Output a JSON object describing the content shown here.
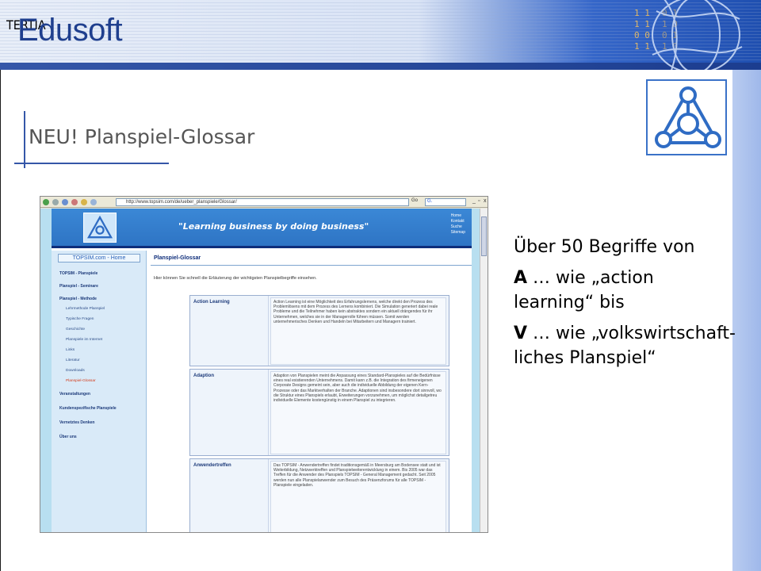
{
  "brand": {
    "logo_text": "Edusoft",
    "logo_tag": "TERTIA",
    "binary_a": "1 1\n1 1\n0 0\n1 1",
    "binary_b": "0 1\n1 0\n0 1\n1 0"
  },
  "slide": {
    "title": "NEU! Planspiel-Glossar",
    "bullets": {
      "p1": "Über 50 Begriffe von",
      "p2_letter": "A",
      "p2_rest": " … wie „action learning“ bis",
      "p3_letter": "V",
      "p3_rest": " … wie „volkswirtschaft-liches Planspiel“"
    }
  },
  "browser": {
    "address": "http://www.topsim.com/de/ueber_planspiele/Glossar/",
    "go_label": "Go",
    "search_value": "G.",
    "window_controls": [
      "_",
      "▫",
      "x"
    ]
  },
  "site": {
    "slogan": "\"Learning business by doing business\"",
    "top_links": [
      "Home",
      "Kontakt",
      "Suche",
      "Sitemap"
    ],
    "home_button": "TOPSIM.com - Home",
    "nav": [
      {
        "label": "TOPSIM - Planspiele",
        "type": "main"
      },
      {
        "label": "Planspiel - Seminare",
        "type": "main"
      },
      {
        "label": "Planspiel - Methode",
        "type": "main"
      },
      {
        "label": "Lehrmethode Planspiel",
        "type": "sub"
      },
      {
        "label": "Typische Fragen",
        "type": "sub"
      },
      {
        "label": "Geschichte",
        "type": "sub"
      },
      {
        "label": "Planspiele im Internet",
        "type": "sub"
      },
      {
        "label": "Links",
        "type": "sub"
      },
      {
        "label": "Literatur",
        "type": "sub"
      },
      {
        "label": "Downloads",
        "type": "sub"
      },
      {
        "label": "Planspiel-Glossar",
        "type": "sub-active"
      },
      {
        "label": "Veranstaltungen",
        "type": "main"
      },
      {
        "label": "Kundenspezifische Planspiele",
        "type": "main"
      },
      {
        "label": "Vernetztes Denken",
        "type": "main"
      },
      {
        "label": "Über uns",
        "type": "main"
      }
    ],
    "page_title": "Planspiel-Glossar",
    "intro": "Hier können Sie schnell die Erläuterung der wichtigsten Planspielbegriffe einsehen.",
    "glossary": [
      {
        "term": "Action Learning",
        "desc": "Action Learning ist eine Möglichkeit des Erfahrungslernens, welche direkt den Prozess des Problemlösens mit dem Prozess des Lernens kombiniert. Die Simulation generiert dabei reale Probleme und die Teilnehmer haben kein abstraktes sondern ein aktuell drängendes für ihr Unternehmen, welches sie in der Managerrolle führen müssen. Somit werden unternehmerisches Denken und Handeln bei Mitarbeitern und Managern trainiert."
      },
      {
        "term": "Adaption",
        "desc": "Adaption von Planspielen meint die Anpassung eines Standard-Planspieles auf die Bedürfnisse eines real existierenden Unternehmens. Damit kann z.B. die Integration des firmeneigenen Corporate Designs gemeint sein, aber auch die individuelle Abbildung der eigenen Kern-Prozesse oder das Marktverhalten der Branche. Adaptionen sind insbesondere dort sinnvoll, wo die Struktur eines Planspiels erlaubt, Erweiterungen vorzunehmen, um möglichst detailgetreu individuelle Elemente kostengünstig in einem Planspiel zu integrieren."
      },
      {
        "term": "Anwendertreffen",
        "desc": "Das TOPSIM - Anwendertreffen findet traditionsgemäß in Meersburg am Bodensee statt und ist Weiterbildung, Netzwerktreffen und Planspielweiterentwicklung in einem. Bis 2005 war das Treffen für die Anwender des Planspiels TOPSIM - General Management gedacht. Seit 2005 werden nun alle Planspielanwender zum Besuch des Präsenzforums für alle TOPSIM - Planspiele eingeladen."
      }
    ]
  },
  "colors": {
    "brand_blue": "#1f3f8e",
    "accent_blue": "#3557a8",
    "side_band": "#b9ccf0",
    "nav_active": "#d43b1a"
  },
  "icons": [
    "topsim-emblem-icon",
    "globe-swirl-icon"
  ]
}
